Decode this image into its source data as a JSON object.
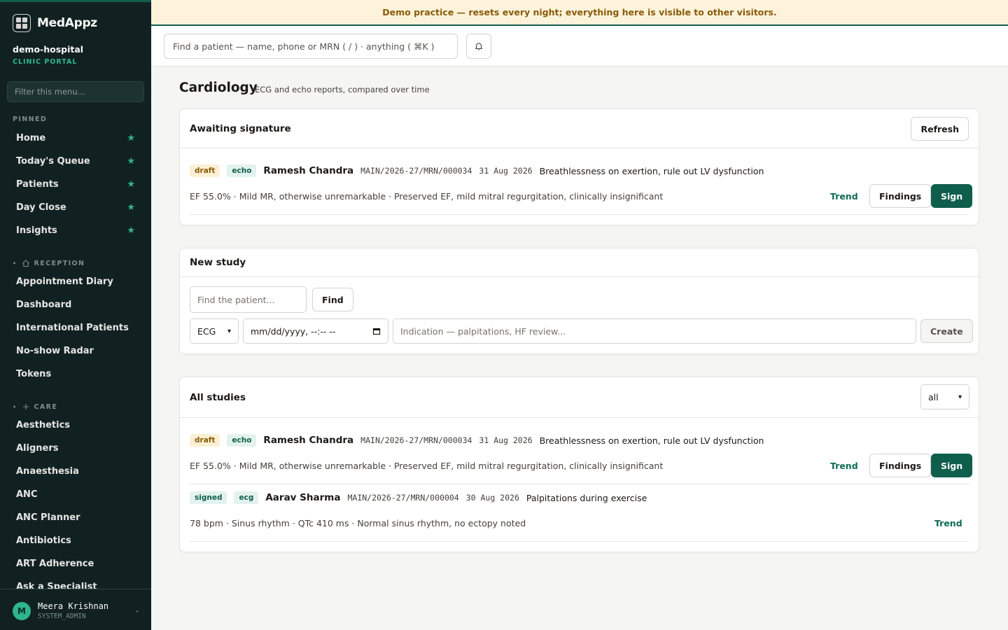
{
  "app": {
    "brand": "MedAppz",
    "tenant": "demo-hospital",
    "tenant_sub": "CLINIC PORTAL"
  },
  "banner": "Demo practice — resets every night; everything here is visible to other visitors.",
  "sidebar": {
    "filter_placeholder": "Filter this menu...",
    "pinned_label": "PINNED",
    "pinned": [
      {
        "label": "Home"
      },
      {
        "label": "Today's Queue"
      },
      {
        "label": "Patients"
      },
      {
        "label": "Day Close"
      },
      {
        "label": "Insights"
      }
    ],
    "reception_label": "RECEPTION",
    "reception": [
      {
        "label": "Appointment Diary"
      },
      {
        "label": "Dashboard"
      },
      {
        "label": "International Patients"
      },
      {
        "label": "No-show Radar"
      },
      {
        "label": "Tokens"
      }
    ],
    "care_label": "CARE",
    "care": [
      {
        "label": "Aesthetics"
      },
      {
        "label": "Aligners"
      },
      {
        "label": "Anaesthesia"
      },
      {
        "label": "ANC"
      },
      {
        "label": "ANC Planner"
      },
      {
        "label": "Antibiotics"
      },
      {
        "label": "ART Adherence"
      },
      {
        "label": "Ask a Specialist"
      }
    ],
    "user": {
      "initial": "M",
      "name": "Meera Krishnan",
      "role": "SYSTEM_ADMIN"
    }
  },
  "topbar": {
    "search_placeholder": "Find a patient — name, phone or MRN ( / ) · anything ( ⌘K )"
  },
  "page": {
    "title": "Cardiology",
    "subtitle": "ECG and echo reports, compared over time"
  },
  "awaiting": {
    "title": "Awaiting signature",
    "refresh_label": "Refresh",
    "rows": [
      {
        "status": "draft",
        "type": "echo",
        "patient": "Ramesh Chandra",
        "mrn": "MAIN/2026-27/MRN/000034",
        "date": "31 Aug 2026",
        "indication": "Breathlessness on exertion, rule out LV dysfunction",
        "findings": "EF 55.0% · Mild MR, otherwise unremarkable · Preserved EF, mild mitral regurgitation, clinically insignificant",
        "trend": "Trend",
        "findings_btn": "Findings",
        "sign_btn": "Sign"
      }
    ]
  },
  "new_study": {
    "title": "New study",
    "patient_placeholder": "Find the patient...",
    "find_label": "Find",
    "modality": "ECG",
    "datetime_placeholder": "mm/dd/yyyy, --:-- --",
    "indication_placeholder": "Indication — palpitations, HF review...",
    "create_label": "Create"
  },
  "all_studies": {
    "title": "All studies",
    "filter_value": "all",
    "rows": [
      {
        "status": "draft",
        "type": "echo",
        "patient": "Ramesh Chandra",
        "mrn": "MAIN/2026-27/MRN/000034",
        "date": "31 Aug 2026",
        "indication": "Breathlessness on exertion, rule out LV dysfunction",
        "findings": "EF 55.0% · Mild MR, otherwise unremarkable · Preserved EF, mild mitral regurgitation, clinically insignificant",
        "trend": "Trend",
        "findings_btn": "Findings",
        "sign_btn": "Sign"
      },
      {
        "status": "signed",
        "type": "ecg",
        "patient": "Aarav Sharma",
        "mrn": "MAIN/2026-27/MRN/000004",
        "date": "30 Aug 2026",
        "indication": "Palpitations during exercise",
        "findings": "78 bpm · Sinus rhythm · QTc 410 ms · Normal sinus rhythm, no ectopy noted",
        "trend": "Trend"
      }
    ]
  },
  "colors": {
    "accent": "#0f5e4c",
    "sidebar_bg": "#112121",
    "banner_bg": "#fcf3da",
    "star": "#2fb58e"
  },
  "icons": {
    "notifications": "bell-icon",
    "pinned": "star-icon",
    "reception": "home-icon",
    "care": "plus-icon",
    "calendar": "calendar-icon"
  }
}
